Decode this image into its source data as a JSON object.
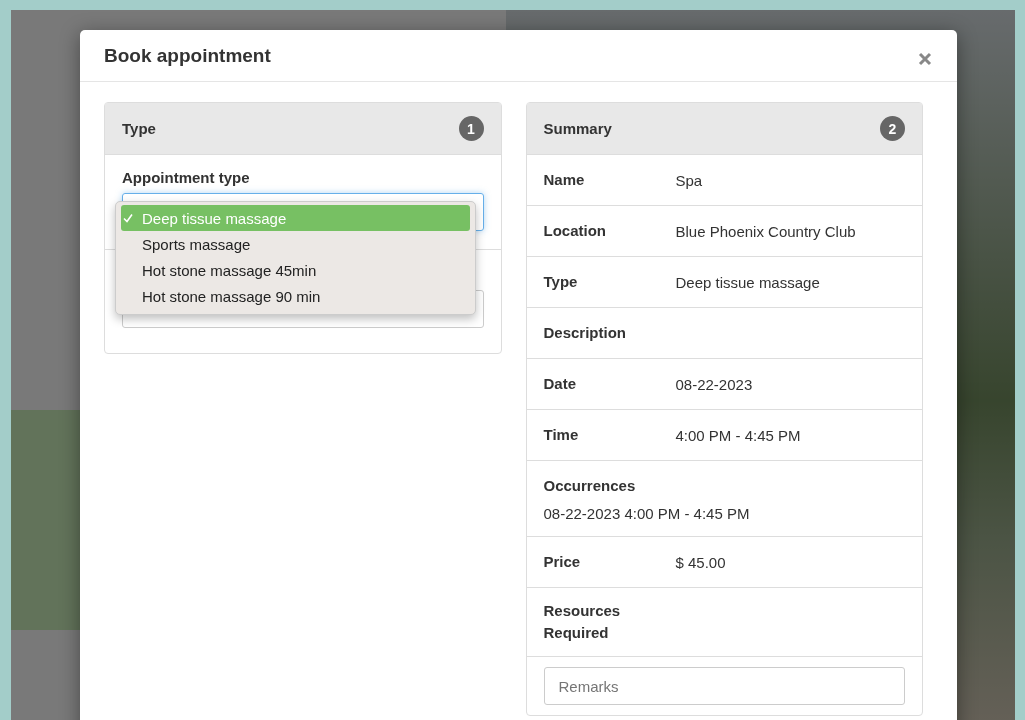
{
  "modal": {
    "title": "Book appointment"
  },
  "type_panel": {
    "title": "Type",
    "step": "1",
    "field_label": "Appointment type",
    "options": [
      {
        "label": "Deep tissue massage",
        "selected": true
      },
      {
        "label": "Sports massage",
        "selected": false
      },
      {
        "label": "Hot stone massage 45min",
        "selected": false
      },
      {
        "label": "Hot stone massage 90 min",
        "selected": false
      }
    ]
  },
  "summary_panel": {
    "title": "Summary",
    "step": "2",
    "rows": [
      {
        "kind": "inline",
        "label": "Name",
        "value": "Spa"
      },
      {
        "kind": "inline",
        "label": "Location",
        "value": "Blue Phoenix Country Club"
      },
      {
        "kind": "inline",
        "label": "Type",
        "value": "Deep tissue massage"
      },
      {
        "kind": "inline",
        "label": "Description",
        "value": ""
      },
      {
        "kind": "inline",
        "label": "Date",
        "value": "08-22-2023"
      },
      {
        "kind": "inline",
        "label": "Time",
        "value": "4:00 PM - 4:45 PM"
      },
      {
        "kind": "stacked",
        "label": "Occurrences",
        "value": "08-22-2023 4:00 PM - 4:45 PM"
      },
      {
        "kind": "inline",
        "label": "Price",
        "value": "$ 45.00"
      },
      {
        "kind": "inline",
        "label": "Resources Required",
        "value": ""
      }
    ],
    "remarks": {
      "placeholder": "Remarks"
    }
  }
}
